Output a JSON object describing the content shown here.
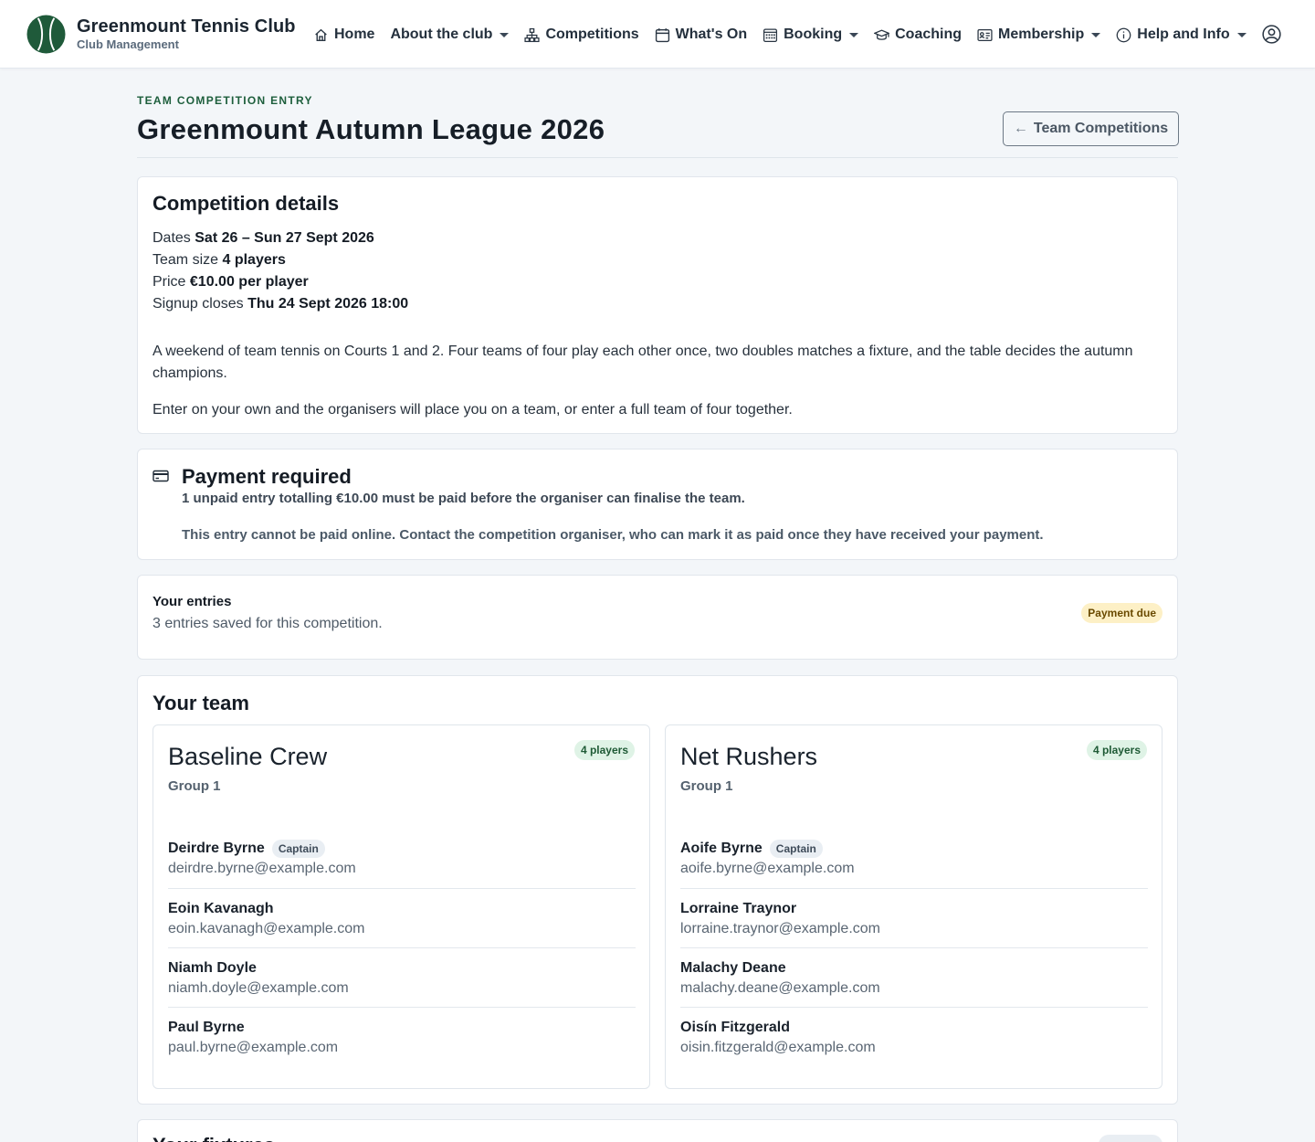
{
  "brand": {
    "name": "Greenmount Tennis Club",
    "subtitle": "Club Management",
    "logo_color": "#1f5a3a"
  },
  "nav": [
    {
      "label": "Home",
      "icon": "home-icon",
      "dropdown": false
    },
    {
      "label": "About the club",
      "icon": "",
      "dropdown": true
    },
    {
      "label": "Competitions",
      "icon": "diagram-icon",
      "dropdown": false
    },
    {
      "label": "What's On",
      "icon": "calendar-icon",
      "dropdown": false
    },
    {
      "label": "Booking",
      "icon": "grid-calendar-icon",
      "dropdown": true
    },
    {
      "label": "Coaching",
      "icon": "mortarboard-icon",
      "dropdown": false
    },
    {
      "label": "Membership",
      "icon": "id-card-icon",
      "dropdown": true
    },
    {
      "label": "Help and Info",
      "icon": "info-icon",
      "dropdown": true
    }
  ],
  "page": {
    "eyebrow": "TEAM COMPETITION ENTRY",
    "title": "Greenmount Autumn League 2026",
    "back_label": "Team Competitions"
  },
  "details": {
    "title": "Competition details",
    "rows": [
      {
        "label": "Dates",
        "value": "Sat 26 – Sun 27 Sept 2026"
      },
      {
        "label": "Team size",
        "value": "4 players"
      },
      {
        "label": "Price",
        "value": "€10.00 per player"
      },
      {
        "label": "Signup closes",
        "value": "Thu 24 Sept 2026 18:00"
      }
    ],
    "description": "A weekend of team tennis on Courts 1 and 2. Four teams of four play each other once, two doubles matches a fixture, and the table decides the autumn champions.",
    "note": "Enter on your own and the organisers will place you on a team, or enter a full team of four together."
  },
  "payment": {
    "title": "Payment required",
    "line1": "1 unpaid entry totalling €10.00 must be paid before the organiser can finalise the team.",
    "line2": "This entry cannot be paid online. Contact the competition organiser, who can mark it as paid once they have received your payment."
  },
  "entries": {
    "title": "Your entries",
    "subtitle": "3 entries saved for this competition.",
    "badge": "Payment due"
  },
  "team_section": {
    "title": "Your team",
    "teams": [
      {
        "name": "Baseline Crew",
        "group": "Group 1",
        "badge": "4 players",
        "members": [
          {
            "name": "Deirdre Byrne",
            "email": "deirdre.byrne@example.com",
            "captain": "Captain"
          },
          {
            "name": "Eoin Kavanagh",
            "email": "eoin.kavanagh@example.com",
            "captain": ""
          },
          {
            "name": "Niamh Doyle",
            "email": "niamh.doyle@example.com",
            "captain": ""
          },
          {
            "name": "Paul Byrne",
            "email": "paul.byrne@example.com",
            "captain": ""
          }
        ]
      },
      {
        "name": "Net Rushers",
        "group": "Group 1",
        "badge": "4 players",
        "members": [
          {
            "name": "Aoife Byrne",
            "email": "aoife.byrne@example.com",
            "captain": "Captain"
          },
          {
            "name": "Lorraine Traynor",
            "email": "lorraine.traynor@example.com",
            "captain": ""
          },
          {
            "name": "Malachy Deane",
            "email": "malachy.deane@example.com",
            "captain": ""
          },
          {
            "name": "Oisín Fitzgerald",
            "email": "oisin.fitzgerald@example.com",
            "captain": ""
          }
        ]
      }
    ]
  },
  "next_section": {
    "title": "Your fixtures"
  }
}
